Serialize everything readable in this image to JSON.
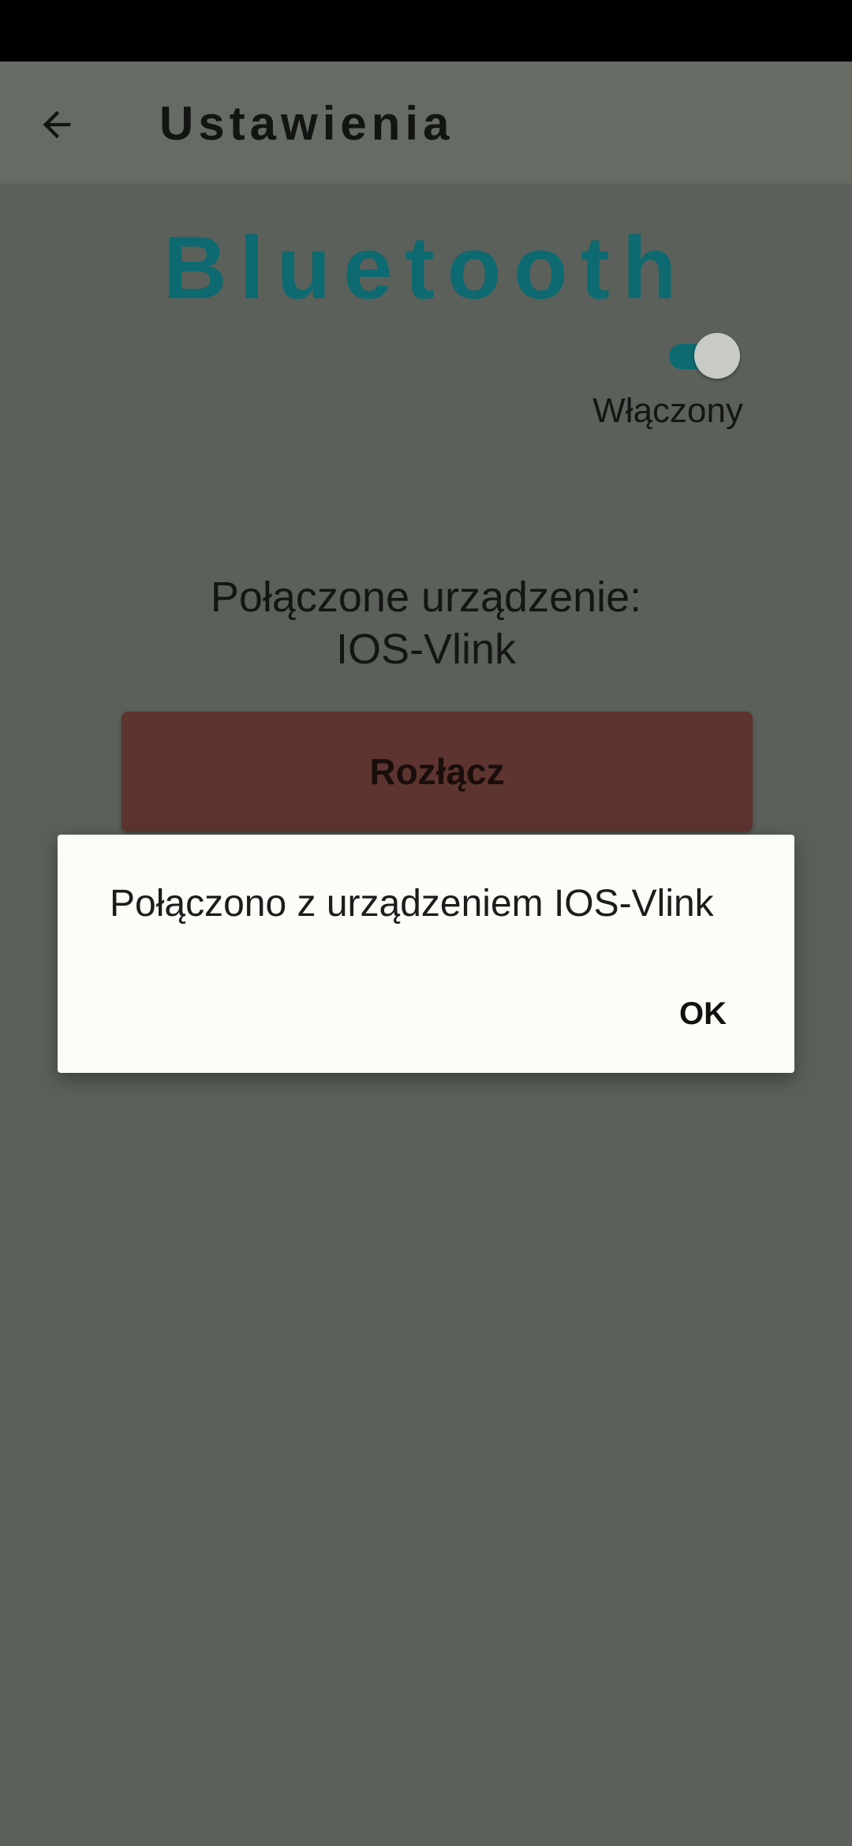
{
  "header": {
    "back_icon": "arrow-left-icon",
    "title": "Ustawienia"
  },
  "bluetooth": {
    "title": "Bluetooth",
    "toggle_on": true,
    "toggle_label": "Włączony",
    "connected_label": "Połączone urządzenie:",
    "device_name": "IOS-Vlink",
    "disconnect_label": "Rozłącz"
  },
  "dialog": {
    "message": "Połączono z urządzeniem IOS-Vlink",
    "ok_label": "OK"
  },
  "colors": {
    "accent": "#0c6a70",
    "disconnect": "#5d342f",
    "scrim_background": "#5b605a",
    "dialog_background": "#fbfdf9"
  }
}
